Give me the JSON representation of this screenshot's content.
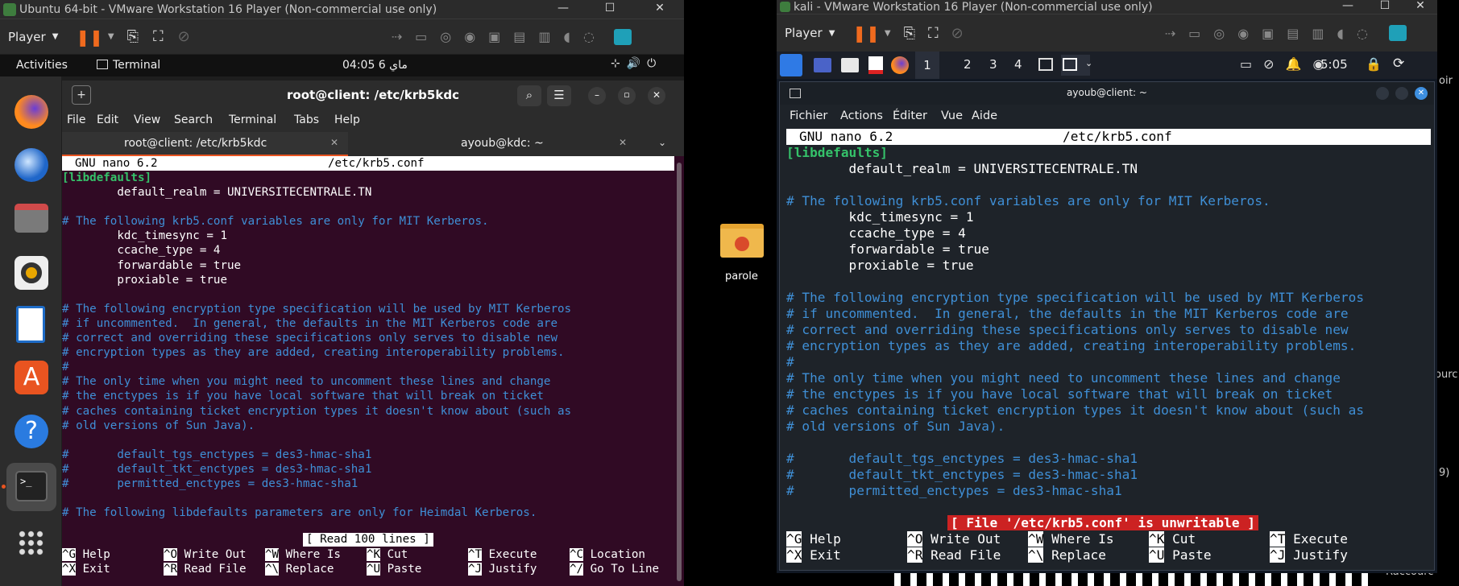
{
  "ubuntu": {
    "title": "Ubuntu 64-bit - VMware Workstation 16 Player (Non-commercial use only)",
    "player_label": "Player",
    "activities": "Activities",
    "terminal_app": "Terminal",
    "clock": "04:05 ماي 6",
    "term_title": "root@client: /etc/krb5kdc",
    "menu": [
      "File",
      "Edit",
      "View",
      "Search",
      "Terminal",
      "Tabs",
      "Help"
    ],
    "tabs": [
      "root@client: /etc/krb5kdc",
      "ayoub@kdc: ~"
    ],
    "nano_header_left": "GNU nano 6.2",
    "nano_header_file": "/etc/krb5.conf",
    "status": "[ Read 100 lines ]",
    "lines": [
      "[libdefaults]",
      "        default_realm = UNIVERSITECENTRALE.TN",
      "",
      "# The following krb5.conf variables are only for MIT Kerberos.",
      "        kdc_timesync = 1",
      "        ccache_type = 4",
      "        forwardable = true",
      "        proxiable = true",
      "",
      "# The following encryption type specification will be used by MIT Kerberos",
      "# if uncommented.  In general, the defaults in the MIT Kerberos code are",
      "# correct and overriding these specifications only serves to disable new",
      "# encryption types as they are added, creating interoperability problems.",
      "#",
      "# The only time when you might need to uncomment these lines and change",
      "# the enctypes is if you have local software that will break on ticket",
      "# caches containing ticket encryption types it doesn't know about (such as",
      "# old versions of Sun Java).",
      "",
      "#       default_tgs_enctypes = des3-hmac-sha1",
      "#       default_tkt_enctypes = des3-hmac-sha1",
      "#       permitted_enctypes = des3-hmac-sha1",
      "",
      "# The following libdefaults parameters are only for Heimdal Kerberos."
    ],
    "shortcuts": [
      [
        [
          "^G",
          "Help"
        ],
        [
          "^O",
          "Write Out"
        ],
        [
          "^W",
          "Where Is"
        ],
        [
          "^K",
          "Cut"
        ],
        [
          "^T",
          "Execute"
        ],
        [
          "^C",
          "Location"
        ]
      ],
      [
        [
          "^X",
          "Exit"
        ],
        [
          "^R",
          "Read File"
        ],
        [
          "^\\",
          "Replace"
        ],
        [
          "^U",
          "Paste"
        ],
        [
          "^J",
          "Justify"
        ],
        [
          "^/",
          "Go To Line"
        ]
      ]
    ]
  },
  "desktop": {
    "folder_label": "parole",
    "edge_texts": [
      "oir",
      "ourc",
      "9)",
      "Raccourc"
    ]
  },
  "kali": {
    "title": "kali - VMware Workstation 16 Player (Non-commercial use only)",
    "player_label": "Player",
    "workspaces": [
      "1",
      "2",
      "3",
      "4"
    ],
    "clock": "5:05",
    "term_title": "ayoub@client: ~",
    "menu": [
      "Fichier",
      "Actions",
      "Éditer",
      "Vue",
      "Aide"
    ],
    "nano_header_left": "GNU nano 6.2",
    "nano_header_file": "/etc/krb5.conf",
    "status": "[ File '/etc/krb5.conf' is unwritable ]",
    "lines": [
      "[libdefaults]",
      "        default_realm = UNIVERSITECENTRALE.TN",
      "",
      "# The following krb5.conf variables are only for MIT Kerberos.",
      "        kdc_timesync = 1",
      "        ccache_type = 4",
      "        forwardable = true",
      "        proxiable = true",
      "",
      "# The following encryption type specification will be used by MIT Kerberos",
      "# if uncommented.  In general, the defaults in the MIT Kerberos code are",
      "# correct and overriding these specifications only serves to disable new",
      "# encryption types as they are added, creating interoperability problems.",
      "#",
      "# The only time when you might need to uncomment these lines and change",
      "# the enctypes is if you have local software that will break on ticket",
      "# caches containing ticket encryption types it doesn't know about (such as",
      "# old versions of Sun Java).",
      "",
      "#       default_tgs_enctypes = des3-hmac-sha1",
      "#       default_tkt_enctypes = des3-hmac-sha1",
      "#       permitted_enctypes = des3-hmac-sha1"
    ],
    "shortcuts": [
      [
        [
          "^G",
          "Help"
        ],
        [
          "^O",
          "Write Out"
        ],
        [
          "^W",
          "Where Is"
        ],
        [
          "^K",
          "Cut"
        ],
        [
          "^T",
          "Execute"
        ]
      ],
      [
        [
          "^X",
          "Exit"
        ],
        [
          "^R",
          "Read File"
        ],
        [
          "^\\",
          "Replace"
        ],
        [
          "^U",
          "Paste"
        ],
        [
          "^J",
          "Justify"
        ]
      ]
    ]
  },
  "colors": {
    "ubuntu_term_bg": "#300a24",
    "kali_term_bg": "#1e2329",
    "comment": "#3f8fd6",
    "label_green": "#35c26a",
    "status_red": "#cc2222"
  }
}
